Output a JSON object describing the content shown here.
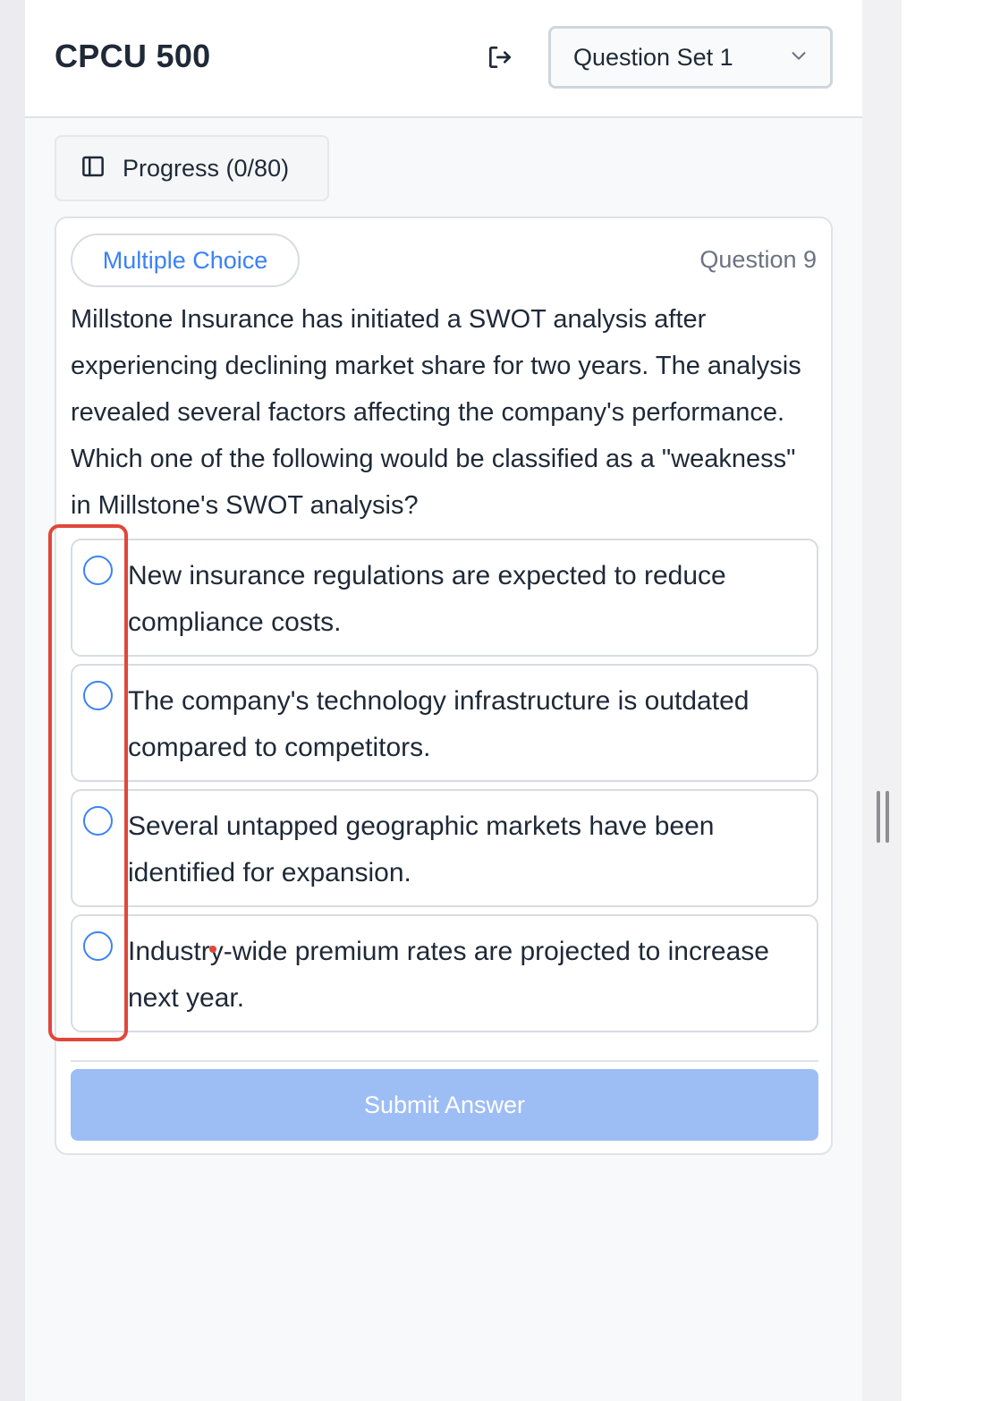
{
  "header": {
    "title": "CPCU 500",
    "logout_icon": "logout-icon",
    "question_set": {
      "selected": "Question Set 1",
      "icon": "chevron-down-icon"
    }
  },
  "progress": {
    "label": "Progress (0/80)",
    "icon": "sidebar-panel-icon"
  },
  "question": {
    "type": "Multiple Choice",
    "number": "Question 9",
    "text": "Millstone Insurance has initiated a SWOT analysis after experiencing declining market share for two years. The analysis revealed several factors affecting the company's performance. Which one of the following would be classified as a \"weakness\" in Millstone's SWOT analysis?",
    "options": [
      {
        "text": "New insurance regulations are expected to reduce compliance costs.",
        "selected": false
      },
      {
        "text": "The company's technology infrastructure is outdated compared to competitors.",
        "selected": false
      },
      {
        "text": "Several untapped geographic markets have been identified for expansion.",
        "selected": false
      },
      {
        "text": "Industry-wide premium rates are projected to increase next year.",
        "selected": false
      }
    ],
    "submit_label": "Submit Answer"
  },
  "colors": {
    "accent": "#3b82f6",
    "submit_disabled": "#9dbdf5",
    "highlight": "#e0473a"
  }
}
